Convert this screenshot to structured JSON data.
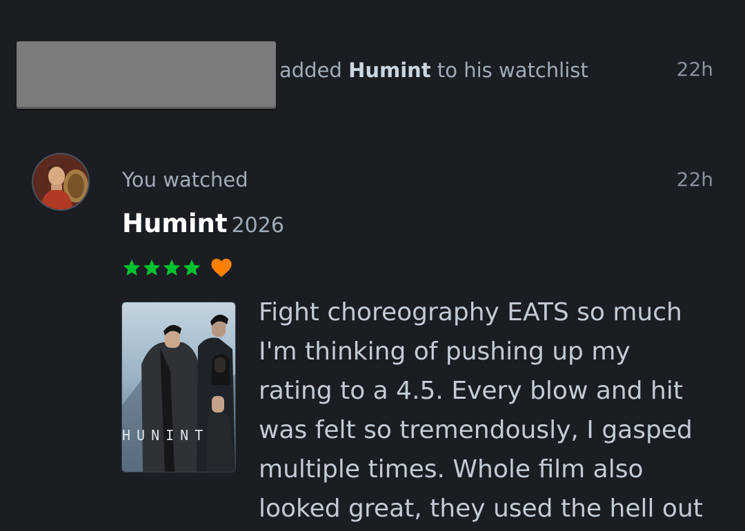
{
  "activity1": {
    "redacted": true,
    "prefix": "added",
    "film": "Humint",
    "suffix": "to his watchlist",
    "time": "22h"
  },
  "entry": {
    "avatar_icon": "user-avatar",
    "action": "You watched",
    "time": "22h",
    "film_title": "Humint",
    "film_year": "2026",
    "rating_stars": 4,
    "liked": true,
    "star_color": "#00c030",
    "heart_color": "#ff8000",
    "poster_title": "HUNINT",
    "review_lines": [
      "Fight choreography EATS so much",
      "I'm thinking of pushing up my",
      "rating to a 4.5. Every blow and hit",
      "was felt so tremendously, I gasped",
      "multiple times. Whole film also",
      "looked great, they used the hell out"
    ]
  }
}
